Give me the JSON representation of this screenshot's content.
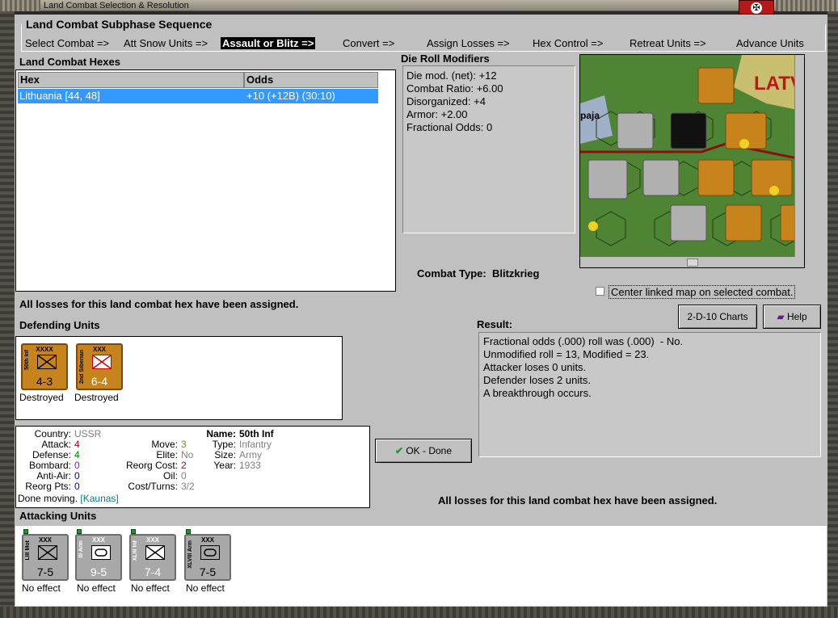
{
  "window": {
    "title": "Land Combat Selection & Resolution"
  },
  "sequence": {
    "title": "Land Combat Subphase Sequence",
    "steps": [
      "Select Combat =>",
      "Att Snow Units =>",
      "Assault or Blitz =>",
      "Convert =>",
      "Assign Losses =>",
      "Hex Control =>",
      "Retreat Units =>",
      "Advance Units"
    ]
  },
  "hexes": {
    "title": "Land Combat Hexes",
    "headers": [
      "Hex",
      "Odds"
    ],
    "rows": [
      {
        "hex": "Lithuania [44, 48]",
        "odds": "+10 (+12B) (30:10)"
      }
    ]
  },
  "modifiers": {
    "title": "Die Roll Modifiers",
    "lines": [
      "Die mod. (net): +12",
      "",
      "Combat Ratio: +6.00",
      "Disorganized: +4",
      "Armor: +2.00",
      "Fractional Odds: 0"
    ]
  },
  "combat_type": {
    "label": "Combat Type:",
    "value": "Blitzkrieg"
  },
  "map": {
    "region_label": "LATV",
    "place_label": "paja",
    "center_checkbox": "Center linked map on selected combat."
  },
  "losses_message": "All losses for this land combat hex have been assigned.",
  "buttons": {
    "charts": "2-D-10 Charts",
    "help": "Help",
    "ok": "OK - Done"
  },
  "defending": {
    "title": "Defending Units",
    "units": [
      {
        "name": "50th Inf",
        "size": "XXXX",
        "values": "4-3",
        "status": "Destroyed",
        "symbol": "infantry"
      },
      {
        "name": "2nd Siberian",
        "size": "XXX",
        "values": "6-4",
        "status": "Destroyed",
        "symbol": "infantry"
      }
    ]
  },
  "result": {
    "title": "Result:",
    "lines": [
      "Fractional odds (.000) roll was (.000)  - No.",
      "Unmodified roll = 13, Modified = 23.",
      "Attacker loses 0 units.",
      "Defender loses 2 units.",
      "A breakthrough occurs."
    ]
  },
  "unit_info": {
    "country_label": "Country:",
    "country": "USSR",
    "attack_label": "Attack:",
    "attack": "4",
    "defense_label": "Defense:",
    "defense": "4",
    "bombard_label": "Bombard:",
    "bombard": "0",
    "antiair_label": "Anti-Air:",
    "antiair": "0",
    "reorgpts_label": "Reorg Pts:",
    "reorgpts": "0",
    "move_label": "Move:",
    "move": "3",
    "elite_label": "Elite:",
    "elite": "No",
    "reorgcost_label": "Reorg Cost:",
    "reorgcost": "2",
    "oil_label": "Oil:",
    "oil": "0",
    "costturns_label": "Cost/Turns:",
    "costturns": "3/2",
    "name_label": "Name:",
    "name": "50th Inf",
    "type_label": "Type:",
    "type": "Infantry",
    "size_label": "Size:",
    "size": "Army",
    "year_label": "Year:",
    "year": "1933",
    "done_text": "Done moving.",
    "location": "[Kaunas]"
  },
  "attacking": {
    "title": "Attacking Units",
    "units": [
      {
        "name": "LIII Mot",
        "size": "XXX",
        "values": "7-5",
        "status": "No effect",
        "symbol": "motorized"
      },
      {
        "name": "III Arm",
        "size": "XXX",
        "values": "9-5",
        "status": "No effect",
        "symbol": "armor"
      },
      {
        "name": "XLIII Inf",
        "size": "XXX",
        "values": "7-4",
        "status": "No effect",
        "symbol": "infantry"
      },
      {
        "name": "XLVIII Arm",
        "size": "XXX",
        "values": "7-5",
        "status": "No effect",
        "symbol": "armor"
      }
    ]
  },
  "colors": {
    "soviet": "#c8841c",
    "german": "#a8a8a8",
    "selection": "#3399ff"
  }
}
